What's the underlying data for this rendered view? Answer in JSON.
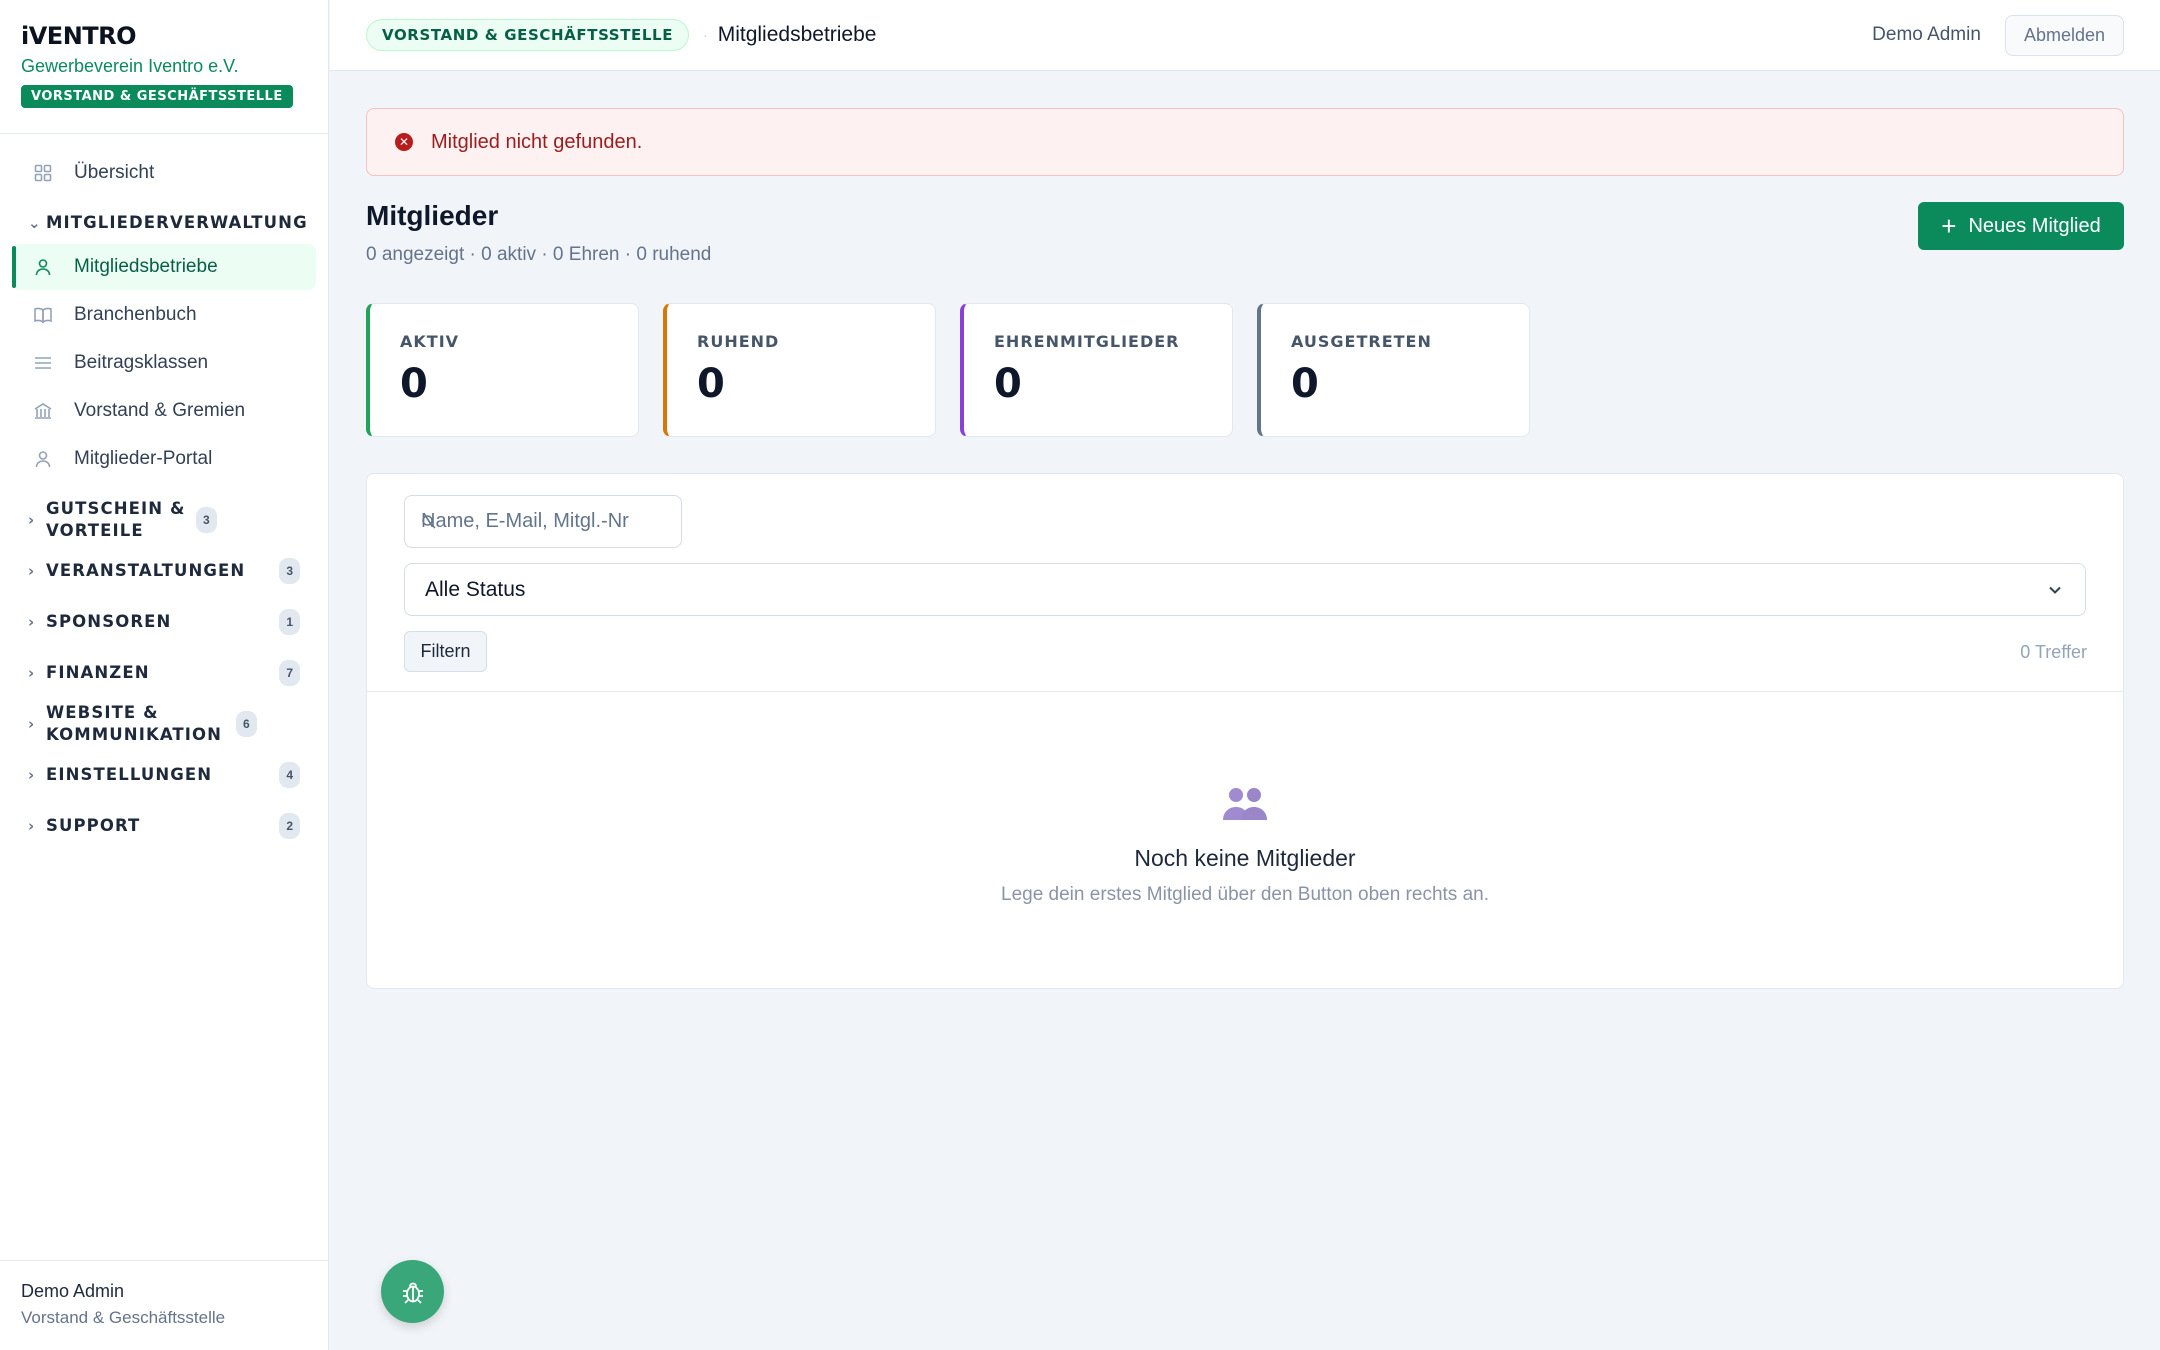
{
  "brand": {
    "logo": "iVENTRO",
    "org": "Gewerbeverein Iventro e.V.",
    "badge": "VORSTAND & GESCHÄFTSSTELLE"
  },
  "sidebar": {
    "overview": "Übersicht",
    "section_members": "MITGLIEDERVERWALTUNG",
    "items": [
      {
        "label": "Mitgliedsbetriebe",
        "icon": "user-icon"
      },
      {
        "label": "Branchenbuch",
        "icon": "book-icon"
      },
      {
        "label": "Beitragsklassen",
        "icon": "list-icon"
      },
      {
        "label": "Vorstand & Gremien",
        "icon": "building-icon"
      },
      {
        "label": "Mitglieder-Portal",
        "icon": "user-icon"
      }
    ],
    "groups": [
      {
        "label": "GUTSCHEIN & VORTEILE",
        "count": "3"
      },
      {
        "label": "VERANSTALTUNGEN",
        "count": "3"
      },
      {
        "label": "SPONSOREN",
        "count": "1"
      },
      {
        "label": "FINANZEN",
        "count": "7"
      },
      {
        "label": "WEBSITE & KOMMUNIKATION",
        "count": "6"
      },
      {
        "label": "EINSTELLUNGEN",
        "count": "4"
      },
      {
        "label": "SUPPORT",
        "count": "2"
      }
    ],
    "footer": {
      "name": "Demo Admin",
      "role": "Vorstand & Geschäftsstelle"
    }
  },
  "topbar": {
    "role": "VORSTAND & GESCHÄFTSSTELLE",
    "separator": "·",
    "crumb": "Mitgliedsbetriebe",
    "user": "Demo Admin",
    "logout": "Abmelden"
  },
  "alert": {
    "text": "Mitglied nicht gefunden."
  },
  "page": {
    "title": "Mitglieder",
    "subtitle": "0 angezeigt · 0 aktiv · 0 Ehren · 0 ruhend",
    "new_button": "Neues Mitglied"
  },
  "stats": [
    {
      "label": "AKTIV",
      "value": "0",
      "color": "#22a35a"
    },
    {
      "label": "RUHEND",
      "value": "0",
      "color": "#d97706"
    },
    {
      "label": "EHRENMITGLIEDER",
      "value": "0",
      "color": "#8b3fd9"
    },
    {
      "label": "AUSGETRETEN",
      "value": "0",
      "color": "#64748b"
    }
  ],
  "filters": {
    "search_placeholder": "Name, E-Mail, Mitgl.-Nr",
    "status_value": "Alle Status",
    "filter_button": "Filtern",
    "hits": "0 Treffer"
  },
  "empty": {
    "title": "Noch keine Mitglieder",
    "text": "Lege dein erstes Mitglied über den Button oben rechts an."
  },
  "colors": {
    "accent": "#0b8a5c",
    "alert_bg": "#fdf1f1",
    "alert_text": "#9b1c1c"
  }
}
